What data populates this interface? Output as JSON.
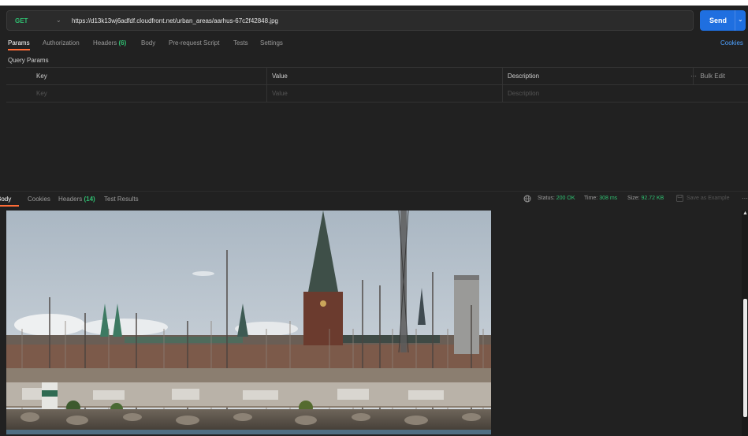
{
  "request": {
    "method": "GET",
    "url": "https://d13k13wj6adfdf.cloudfront.net/urban_areas/aarhus-67c2f42848.jpg",
    "send_label": "Send"
  },
  "request_tabs": {
    "params": "Params",
    "authorization": "Authorization",
    "headers": "Headers",
    "headers_count": "(6)",
    "body": "Body",
    "pre_request": "Pre-request Script",
    "tests": "Tests",
    "settings": "Settings",
    "cookies": "Cookies"
  },
  "query_params": {
    "title": "Query Params",
    "columns": {
      "key": "Key",
      "value": "Value",
      "description": "Description"
    },
    "bulk_edit": "Bulk Edit",
    "bulk_dots": "···",
    "placeholders": {
      "key": "Key",
      "value": "Value",
      "description": "Description"
    }
  },
  "response_tabs": {
    "body": "Body",
    "cookies": "Cookies",
    "headers": "Headers",
    "headers_count": "(14)",
    "test_results": "Test Results"
  },
  "response_status": {
    "status_label": "Status:",
    "status_value": "200 OK",
    "time_label": "Time:",
    "time_value": "308 ms",
    "size_label": "Size:",
    "size_value": "92.72 KB",
    "save_example": "Save as Example",
    "more": "···"
  },
  "colors": {
    "accent_orange": "#ff6c37",
    "send_blue": "#1f6fe0",
    "success_green": "#2fbf71",
    "link_blue": "#4ea1ff"
  },
  "icons": [
    "chevron-down-icon",
    "globe-icon",
    "save-icon",
    "more-icon",
    "scroll-up-icon"
  ]
}
